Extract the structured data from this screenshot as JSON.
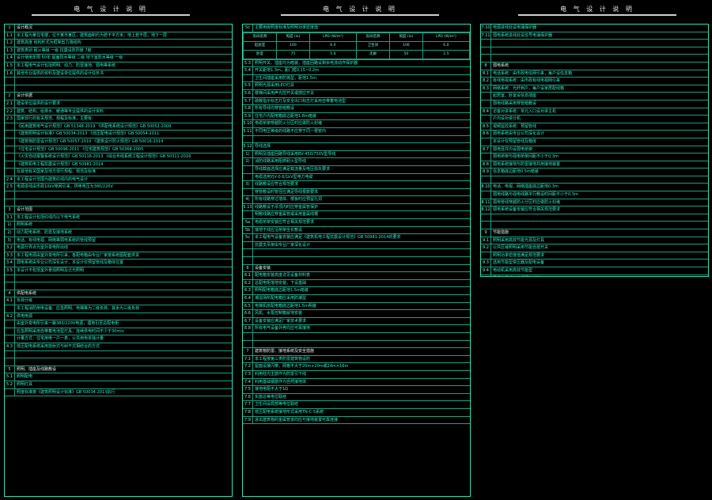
{
  "titles": [
    "电 气 设 计 说 明",
    "电 气 设 计 说 明",
    "电 气 设 计 说 明"
  ],
  "sheet1": {
    "rows": [
      {
        "no": "1",
        "text": "设计概况",
        "head": true
      },
      {
        "no": "1.1",
        "text": "本工程为某住宅楼，位于某市某区，建筑面积约为若干平方米，地上若干层，地下一层"
      },
      {
        "no": "1.2",
        "text": "建筑高度      结构形式为框架剪力墙结构"
      },
      {
        "no": "1.3",
        "text": "建筑类别        耐火等级  一级       抗震设防烈度  7度"
      },
      {
        "no": "1.4",
        "text": "设计使用年限  50年     屋面防水等级  二级     地下室防水等级  一级"
      },
      {
        "no": "1.5",
        "text": "本工程电气设计包括照明、动力、防雷接地、弱电等系统"
      },
      {
        "no": "1.6",
        "text": "其他专业提供的资料及建设单位提供的设计任务书"
      },
      {
        "no": "",
        "text": ""
      },
      {
        "no": "",
        "text": ""
      },
      {
        "no": "2",
        "text": "设计依据",
        "head": true
      },
      {
        "no": "2.1",
        "text": "建设单位提供的设计要求"
      },
      {
        "no": "2.2",
        "text": "建筑、结构、给排水、暖通等专业提供的设计资料"
      },
      {
        "no": "2.3",
        "text": "国家现行的有关规范、规程及标准，主要有："
      },
      {
        "no": "",
        "text": "《民用建筑电气设计规范》GB 51348-2019        《供配电系统设计规范》GB 50052-2009"
      },
      {
        "no": "",
        "text": "《建筑照明设计标准》GB 50034-2013        《低压配电设计规范》GB 50054-2011"
      },
      {
        "no": "",
        "text": "《建筑物防雷设计规范》GB 50057-2010        《建筑设计防火规范》GB 50016-2014"
      },
      {
        "no": "",
        "text": "《住宅设计规范》GB 50096-2011        《住宅建筑规范》GB 50368-2005"
      },
      {
        "no": "",
        "text": "《火灾自动报警系统设计规范》GB 50116-2013      《综合布线系统工程设计规范》GB 50311-2016"
      },
      {
        "no": "",
        "text": "《建筑机电工程抗震设计规范》GB 50981-2014"
      },
      {
        "no": "",
        "text": "及其他有关国家及地方现行规程、规范及标准"
      },
      {
        "no": "2.4",
        "text": "本工程设计范围为建筑红线内的电气设计"
      },
      {
        "no": "2.5",
        "text": "电源进线由市政10kV电网引来，供电电压为380/220V"
      },
      {
        "no": "",
        "text": ""
      },
      {
        "no": "",
        "text": ""
      },
      {
        "no": "3",
        "text": "设计范围",
        "head": true
      },
      {
        "no": "3.1",
        "text": "本工程设计包括红线内以下电气系统"
      },
      {
        "no": "1)",
        "text": "照明系统"
      },
      {
        "no": "2)",
        "text": "动力配电系统、防雷及接地系统"
      },
      {
        "no": "3)",
        "text": "电话、有线电视、网络等弱电系统的管线预留"
      },
      {
        "no": "3.2",
        "text": "电源分界点为室外变电所出线"
      },
      {
        "no": "3.3",
        "text": "本工程电源由室外变电所引来，各配电箱由专业厂家按系统图配套供货"
      },
      {
        "no": "3.4",
        "text": "弱电系统由专业公司深化设计，本设计仅预留管线及箱体位置"
      },
      {
        "no": "3.5",
        "text": "本设计不包括室外景观照明及泛光照明"
      },
      {
        "no": "",
        "text": ""
      },
      {
        "no": "",
        "text": ""
      },
      {
        "no": "4",
        "text": "供配电系统",
        "head": true
      },
      {
        "no": "4.1",
        "text": "负荷分级"
      },
      {
        "no": "",
        "text": "本工程消防用电设备、应急照明、电梯等为二级负荷，其余为三级负荷"
      },
      {
        "no": "4.2",
        "text": "供电电源"
      },
      {
        "no": "",
        "text": "由室外变电所引来一路380/220V电源，埋地引至总配电柜"
      },
      {
        "no": "",
        "text": "应急照明采用自带蓄电池型灯具，连续供电时间不少于30min"
      },
      {
        "no": "",
        "text": "计量方式：住宅用电一户一表，公共用电单独计量"
      },
      {
        "no": "4.3",
        "text": "低压配电系统采用放射式与树干式相结合的方式"
      },
      {
        "no": "",
        "text": ""
      },
      {
        "no": "",
        "text": ""
      },
      {
        "no": "5",
        "text": "照明、插座及线路敷设",
        "head": true
      },
      {
        "no": "5.1",
        "text": "照明配电"
      },
      {
        "no": "5.2",
        "text": "照明灯具"
      },
      {
        "no": "",
        "text": "照度标准按《建筑照明设计标准》GB 50034-2013执行"
      }
    ]
  },
  "sheet2": {
    "table": {
      "caption": "主要用房照度标准及照明功率密度值",
      "header": [
        "房间名称",
        "照度 (lx)",
        "LPD (W/m²)",
        "房间名称",
        "照度 (lx)",
        "LPD (W/m²)"
      ],
      "rows": [
        [
          "起居室",
          "100",
          "6.0",
          "卫生间",
          "100",
          "6.0"
        ],
        [
          "卧室",
          "75",
          "5.0",
          "走廊",
          "50",
          "2.5"
        ]
      ]
    },
    "rows": [
      {
        "no": "5.3",
        "text": "照明开关、插座均为暗装，插座回路设剩余电流动作保护器"
      },
      {
        "no": "5.4",
        "text": "开关距地1.3m，距门框0.15~0.2m"
      },
      {
        "no": "",
        "text": "卫生间插座采用防溅型，距地1.5m"
      },
      {
        "no": "5.5",
        "text": "照明光源采用LED灯具"
      },
      {
        "no": "5.6",
        "text": "楼梯间采用声光控开关或感应开关"
      },
      {
        "no": "5.7",
        "text": "疏散指示标志灯及安全出口标志灯采用自带蓄电池型"
      },
      {
        "no": "5.8",
        "text": "所有导线均穿管暗敷设"
      },
      {
        "no": "5.9",
        "text": "住宅户内配电箱底边距地1.8m暗装"
      },
      {
        "no": "5.10",
        "text": "电缆桥架穿越防火分区时应做防火封堵"
      },
      {
        "no": "5.11",
        "text": "不同电压等级的线路不应穿于同一根管内"
      },
      {
        "no": "",
        "text": ""
      },
      {
        "no": "5.12",
        "text": "导线选择"
      },
      {
        "no": "1)",
        "text": "照明及插座回路导线采用BV-450/750V型导线"
      },
      {
        "no": "2)",
        "text": "消防线路采用阻燃耐火型导线"
      },
      {
        "no": "",
        "text": "导线截面选择应满足载流量及电压损失要求"
      },
      {
        "no": "",
        "text": "电缆选用YJV-0.6/1kV型电力电缆"
      },
      {
        "no": "3)",
        "text": "线路敷设应符合规范要求"
      },
      {
        "no": "",
        "text": "穿管敷设时管径应满足导线根数要求"
      },
      {
        "no": "4)",
        "text": "所有线路穿过墙体、楼板时应预留孔洞"
      },
      {
        "no": "5.13",
        "text": "线路敷设于吊顶内时应穿金属管保护"
      },
      {
        "no": "",
        "text": "明敷线路应穿金属管或采用金属线槽"
      },
      {
        "no": "5a",
        "text": "电缆桥架安装应符合相关规范要求"
      },
      {
        "no": "5b",
        "text": "接地干线应沿桥架全长敷设"
      },
      {
        "no": "5c",
        "text": "本工程电气设备安装应满足《建筑机电工程抗震设计规范》GB 50981-2014的要求"
      },
      {
        "no": "",
        "text": "抗震支吊架由专业厂家深化设计"
      },
      {
        "no": "",
        "text": ""
      },
      {
        "no": "",
        "text": ""
      },
      {
        "no": "6",
        "text": "设备安装",
        "head": true
      },
      {
        "no": "6.1",
        "text": "配电箱安装高度详见设备材料表"
      },
      {
        "no": "6.2",
        "text": "总配电柜落地安装，下设基础"
      },
      {
        "no": "6.3",
        "text": "照明配电箱底边距地1.5m暗装"
      },
      {
        "no": "6.4",
        "text": "潮湿场所配电箱应采用防潮型"
      },
      {
        "no": "6.5",
        "text": "电梯机房配电箱底边距地1.5m明装"
      },
      {
        "no": "6.6",
        "text": "风机、水泵控制箱就地安装"
      },
      {
        "no": "6.7",
        "text": "设备安装应满足厂家技术要求"
      },
      {
        "no": "6.8",
        "text": "所有电气设备外壳均应可靠接地"
      },
      {
        "no": "",
        "text": ""
      },
      {
        "no": "",
        "text": ""
      },
      {
        "no": "7",
        "text": "建筑物防雷、接地系统及安全措施",
        "head": true
      },
      {
        "no": "7.1",
        "text": "本工程按第三类防雷建筑物设防"
      },
      {
        "no": "7.2",
        "text": "屋面设接闪带，网格不大于20m×20m或24m×16m"
      },
      {
        "no": "7.3",
        "text": "利用柱内主筋作为防雷引下线"
      },
      {
        "no": "7.4",
        "text": "利用基础钢筋作为自然接地体"
      },
      {
        "no": "7.5",
        "text": "接地电阻不大于1Ω"
      },
      {
        "no": "7.6",
        "text": "实施总等电位联结"
      },
      {
        "no": "7.7",
        "text": "卫生间设局部等电位联结"
      },
      {
        "no": "7.8",
        "text": "低压配电系统接地形式采用TN-C-S系统"
      },
      {
        "no": "7.9",
        "text": "进出建筑物的金属管道均应与接地装置可靠连接"
      }
    ]
  },
  "sheet3": {
    "rows": [
      {
        "no": "7.10",
        "text": "电源进线处设电涌保护器"
      },
      {
        "no": "7.11",
        "text": "弱电系统进线处设信号电涌保护器"
      },
      {
        "no": "",
        "text": ""
      },
      {
        "no": "",
        "text": ""
      },
      {
        "no": "",
        "text": ""
      },
      {
        "no": "8",
        "text": "弱电系统",
        "head": true
      },
      {
        "no": "8.1",
        "text": "电话系统：由市政电信网引来，每户设信息箱"
      },
      {
        "no": "8.2",
        "text": "有线电视系统：由市政有线电视网引来"
      },
      {
        "no": "8.3",
        "text": "网络系统：光纤到户，每户设家居配线箱"
      },
      {
        "no": "",
        "text": "起居室、卧室设信息插座"
      },
      {
        "no": "",
        "text": "弱电线路采用穿管暗敷设"
      },
      {
        "no": "8.4",
        "text": "访客对讲系统：单元入口设对讲主机"
      },
      {
        "no": "",
        "text": "户内设对讲分机"
      },
      {
        "no": "8.5",
        "text": "视频监控系统：预留管线"
      },
      {
        "no": "8.6",
        "text": "弱电系统由专业公司深化设计"
      },
      {
        "no": "",
        "text": "本设计仅预留管线及箱体"
      },
      {
        "no": "8.7",
        "text": "弱电竖井内设弱电桥架"
      },
      {
        "no": "",
        "text": "弱电桥架与强电桥架间距不小于0.3m"
      },
      {
        "no": "8.8",
        "text": "弱电系统接地与防雷接地共用接地装置"
      },
      {
        "no": "8.9",
        "text": "信息箱底边距地0.5m暗装"
      },
      {
        "no": "",
        "text": ""
      },
      {
        "no": "8.10",
        "text": "电话、电视、网络插座底边距地0.3m"
      },
      {
        "no": "",
        "text": "弱电线路与强电线路平行敷设时间距不小于0.3m"
      },
      {
        "no": "8.11",
        "text": "弱电管线穿越防火分区时应做防火封堵"
      },
      {
        "no": "8.12",
        "text": "弱电系统设备安装应符合相关规范要求"
      },
      {
        "no": "",
        "text": ""
      },
      {
        "no": "",
        "text": ""
      },
      {
        "no": "9",
        "text": "节能措施",
        "head": true
      },
      {
        "no": "9.1",
        "text": "照明采用高效节能光源及灯具"
      },
      {
        "no": "9.2",
        "text": "公共区域照明采用节能自熄开关"
      },
      {
        "no": "",
        "text": "照明功率密度值满足规范要求"
      },
      {
        "no": "9.3",
        "text": "选用节能型变压器及配电设备"
      },
      {
        "no": "9.4",
        "text": "电动机采用高效节能型"
      },
      {
        "no": "",
        "text": "风机水泵采用变频调速控制"
      },
      {
        "no": "9.5",
        "text": "合理选择导线截面，降低线路损耗"
      },
      {
        "no": "",
        "text": "配电系统设无功补偿装置"
      },
      {
        "no": "",
        "text": "功率因数不低于0.9"
      },
      {
        "no": "9.6",
        "text": "分项计量，满足节能监测要求"
      },
      {
        "no": "",
        "text": "电能计量装置符合供电部门要求"
      },
      {
        "no": "9.7",
        "text": "其他未尽事宜按国家现行规范执行"
      },
      {
        "no": "9.8",
        "text": "施工中应与各专业密切配合"
      },
      {
        "no": "",
        "text": "如有疑问及时与设计单位联系"
      },
      {
        "no": "9.9",
        "text": "本说明未尽事宜详见各系统图及平面图"
      },
      {
        "no": "",
        "text": "图中尺寸单位除注明外均以毫米计"
      },
      {
        "no": "9.10",
        "text": "施工单位应严格按图施工，不得擅自修改"
      }
    ]
  }
}
